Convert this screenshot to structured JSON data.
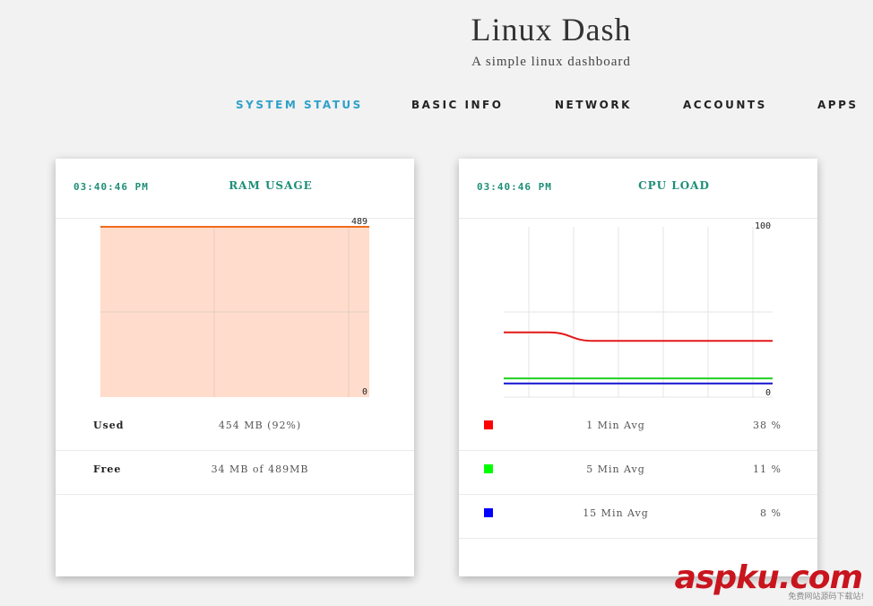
{
  "header": {
    "title": "Linux Dash",
    "subtitle": "A simple linux dashboard"
  },
  "nav": {
    "tabs": [
      {
        "label": "SYSTEM STATUS",
        "active": true
      },
      {
        "label": "BASIC INFO",
        "active": false
      },
      {
        "label": "NETWORK",
        "active": false
      },
      {
        "label": "ACCOUNTS",
        "active": false
      },
      {
        "label": "APPS",
        "active": false
      }
    ]
  },
  "ram": {
    "time": "03:40:46 PM",
    "title": "RAM USAGE",
    "rows": [
      {
        "label": "Used",
        "value": "454 MB (92%)"
      },
      {
        "label": "Free",
        "value": "34 MB of 489MB"
      }
    ]
  },
  "cpu": {
    "time": "03:40:46 PM",
    "title": "CPU LOAD",
    "rows": [
      {
        "label": "1 Min Avg",
        "value": "38 %",
        "color": "#ff0000"
      },
      {
        "label": "5 Min Avg",
        "value": "11 %",
        "color": "#00ff00"
      },
      {
        "label": "15 Min Avg",
        "value": "8 %",
        "color": "#0000ff"
      }
    ]
  },
  "watermark": {
    "text": "aspku.com",
    "sub": "免费网站源码下载站!"
  },
  "chart_data": [
    {
      "type": "area",
      "title": "RAM USAGE",
      "y_top_label": "489",
      "y_bottom_label": "0",
      "ylim": [
        0,
        489
      ],
      "x": [
        0,
        1,
        2,
        3,
        4,
        5,
        6
      ],
      "series": [
        {
          "values": [
            489,
            489,
            489,
            489,
            489,
            489,
            489
          ]
        }
      ],
      "colors": {
        "fill": "#ffdccc",
        "line": "#f06a1c",
        "grid": "#e3cfc5"
      }
    },
    {
      "type": "line",
      "title": "CPU LOAD",
      "y_top_label": "100",
      "y_bottom_label": "0",
      "ylim": [
        0,
        100
      ],
      "x": [
        0,
        1,
        2,
        3,
        4,
        5,
        6
      ],
      "series": [
        {
          "values": [
            38,
            38,
            33,
            33,
            33,
            33,
            33
          ],
          "color": "#e21818"
        },
        {
          "values": [
            11,
            11,
            11,
            11,
            11,
            11,
            11
          ],
          "color": "#1fd01f"
        },
        {
          "values": [
            8,
            8,
            8,
            8,
            8,
            8,
            8
          ],
          "color": "#1414d0"
        }
      ],
      "colors": {
        "grid": "#e6e6e6"
      }
    }
  ]
}
